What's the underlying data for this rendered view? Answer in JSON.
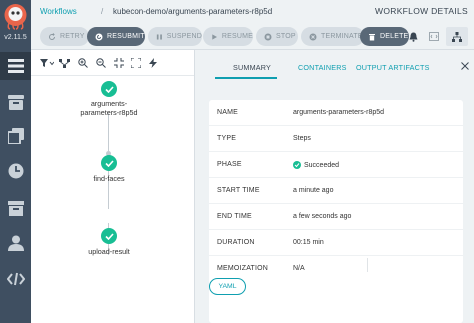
{
  "app": {
    "version": "v2.11.5"
  },
  "header": {
    "breadcrumb_root": "Workflows",
    "breadcrumb_separator": "/",
    "breadcrumb_current": "kubecon-demo/arguments-parameters-r8p5d",
    "title": "WORKFLOW DETAILS"
  },
  "toolbar": {
    "retry": "RETRY",
    "resubmit": "RESUBMIT",
    "suspend": "SUSPEND",
    "resume": "RESUME",
    "stop": "STOP",
    "terminate": "TERMINATE",
    "delete": "DELETE"
  },
  "graph": {
    "nodes": [
      {
        "label": "arguments-parameters-r8p5d",
        "status": "succeeded"
      },
      {
        "label": "find-faces",
        "status": "succeeded"
      },
      {
        "label": "upload-result",
        "status": "succeeded"
      }
    ]
  },
  "details": {
    "tabs": [
      "SUMMARY",
      "CONTAINERS",
      "OUTPUT ARTIFACTS"
    ],
    "active_tab": "SUMMARY",
    "rows": [
      {
        "key": "NAME",
        "value": "arguments-parameters-r8p5d"
      },
      {
        "key": "TYPE",
        "value": "Steps"
      },
      {
        "key": "PHASE",
        "value": "Succeeded"
      },
      {
        "key": "START TIME",
        "value": "a minute ago"
      },
      {
        "key": "END TIME",
        "value": "a few seconds ago"
      },
      {
        "key": "DURATION",
        "value": "00:15 min"
      },
      {
        "key": "MEMOIZATION",
        "value": "N/A"
      }
    ],
    "yaml_button": "YAML"
  },
  "colors": {
    "nav_bg": "#3f4f61",
    "accent": "#0f9fb0",
    "success": "#18be94",
    "button_dark": "#596877"
  },
  "icons": {
    "nav": [
      "menu-icon",
      "archive-icon",
      "templates-icon",
      "clock-icon",
      "box-icon",
      "user-icon",
      "code-icon"
    ]
  }
}
